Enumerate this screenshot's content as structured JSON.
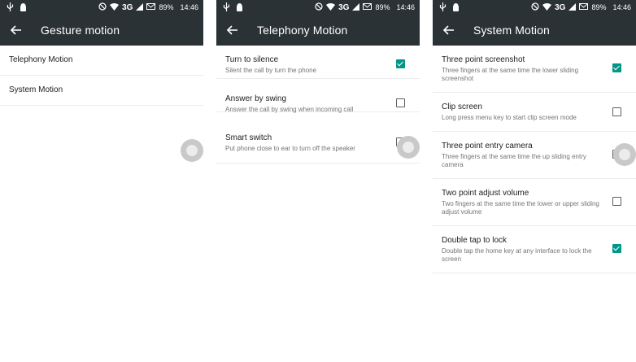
{
  "status_bar": {
    "network": "3G",
    "battery": "89%",
    "time": "14:46"
  },
  "screens": [
    {
      "title": "Gesture motion",
      "items": [
        {
          "title": "Telephony Motion"
        },
        {
          "title": "System Motion"
        }
      ]
    },
    {
      "title": "Telephony Motion",
      "items": [
        {
          "title": "Turn to silence",
          "summary": "Silent the call by turn the phone",
          "checked": true
        },
        {
          "title": "Answer by swing",
          "summary": "Answer the call by swing when incoming call",
          "checked": false
        },
        {
          "title": "Smart switch",
          "summary": "Put phone close to ear to turn off the speaker",
          "checked": false
        }
      ]
    },
    {
      "title": "System Motion",
      "items": [
        {
          "title": "Three point screenshot",
          "summary": "Three fingers at the same time the lower sliding screenshot",
          "checked": true
        },
        {
          "title": "Clip screen",
          "summary": "Long press menu key to start clip screen mode",
          "checked": false
        },
        {
          "title": "Three point entry camera",
          "summary": "Three fingers at the same time the up sliding entry camera",
          "checked": false
        },
        {
          "title": "Two point adjust volume",
          "summary": "Two fingers at the same time the lower or upper sliding adjust volume",
          "checked": false
        },
        {
          "title": "Double tap to lock",
          "summary": "Double tap the home key at any interface to lock the screen",
          "checked": true
        }
      ]
    }
  ],
  "colors": {
    "appbar": "#2a3236",
    "accent": "#009688"
  }
}
